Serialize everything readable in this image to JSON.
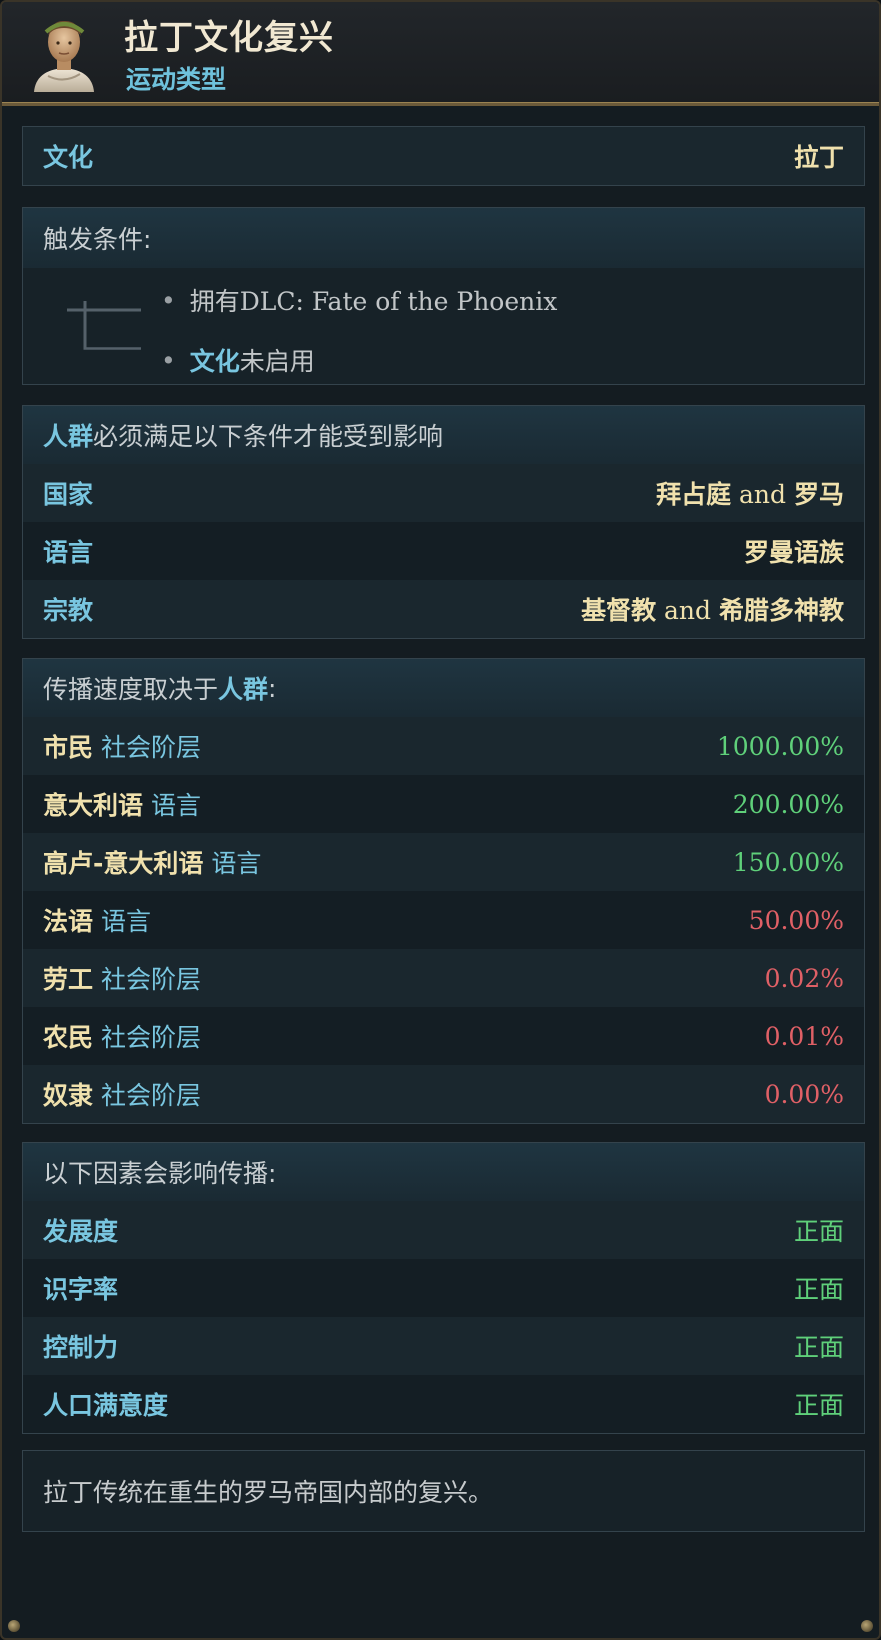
{
  "header": {
    "title": "拉丁文化复兴",
    "subtitle": "运动类型"
  },
  "culture": {
    "label": "文化",
    "value": "拉丁"
  },
  "trigger": {
    "heading": "触发条件:",
    "items": [
      {
        "text": "拥有DLC: Fate of the Phoenix"
      },
      {
        "highlight": "文化",
        "text": "未启用"
      }
    ]
  },
  "requirements": {
    "heading_highlight": "人群",
    "heading_text": "必须满足以下条件才能受到影响",
    "rows": [
      {
        "label": "国家",
        "value_a": "拜占庭",
        "conj": " and ",
        "value_b": "罗马"
      },
      {
        "label": "语言",
        "value_a": "罗曼语族",
        "conj": "",
        "value_b": ""
      },
      {
        "label": "宗教",
        "value_a": "基督教",
        "conj": " and ",
        "value_b": "希腊多神教"
      }
    ]
  },
  "spread": {
    "heading_text": "传播速度取决于",
    "heading_highlight": "人群",
    "heading_suffix": ":",
    "rows": [
      {
        "name": "市民",
        "type": "社会阶层",
        "value": "1000.00%",
        "tone": "positive"
      },
      {
        "name": "意大利语",
        "type": "语言",
        "value": "200.00%",
        "tone": "positive"
      },
      {
        "name": "高卢-意大利语",
        "type": "语言",
        "value": "150.00%",
        "tone": "positive"
      },
      {
        "name": "法语",
        "type": "语言",
        "value": "50.00%",
        "tone": "negative"
      },
      {
        "name": "劳工",
        "type": "社会阶层",
        "value": "0.02%",
        "tone": "negative"
      },
      {
        "name": "农民",
        "type": "社会阶层",
        "value": "0.01%",
        "tone": "negative"
      },
      {
        "name": "奴隶",
        "type": "社会阶层",
        "value": "0.00%",
        "tone": "negative"
      }
    ]
  },
  "factors": {
    "heading": "以下因素会影响传播:",
    "rows": [
      {
        "label": "发展度",
        "value": "正面"
      },
      {
        "label": "识字率",
        "value": "正面"
      },
      {
        "label": "控制力",
        "value": "正面"
      },
      {
        "label": "人口满意度",
        "value": "正面"
      }
    ]
  },
  "description": "拉丁传统在重生的罗马帝国内部的复兴。",
  "colors": {
    "accent_blue": "#79c6e0",
    "accent_gold": "#f0e1ad",
    "positive": "#5fd07a",
    "negative": "#e06066"
  }
}
